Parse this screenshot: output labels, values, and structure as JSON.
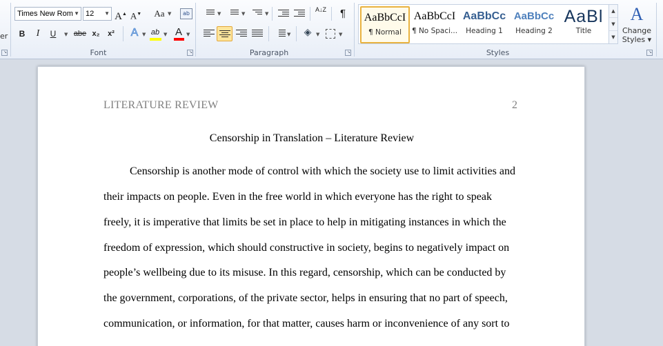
{
  "ribbon": {
    "left_edge_text": "er",
    "font": {
      "family_value": "Times New Rom",
      "size_value": "12",
      "grow_font_label": "A",
      "shrink_font_label": "A",
      "change_case_label": "Aa",
      "bold_label": "B",
      "italic_label": "I",
      "underline_label": "U",
      "strikethrough_label": "abe",
      "subscript_label": "x₂",
      "superscript_label": "x²",
      "text_effects_label": "A",
      "highlight_label": "ab",
      "font_color_label": "A",
      "group_label": "Font"
    },
    "paragraph": {
      "sort_label": "A↓Z",
      "show_marks_label": "¶",
      "group_label": "Paragraph"
    },
    "styles": {
      "items": [
        {
          "sample": "AaBbCcI",
          "name": "¶ Normal"
        },
        {
          "sample": "AaBbCcI",
          "name": "¶ No Spaci..."
        },
        {
          "sample": "AaBbCc",
          "name": "Heading 1"
        },
        {
          "sample": "AaBbCc",
          "name": "Heading 2"
        },
        {
          "sample": "AaBl",
          "name": "Title"
        }
      ],
      "group_label": "Styles",
      "change_styles_line1": "Change",
      "change_styles_line2": "Styles ▾"
    }
  },
  "document": {
    "header_left": "LITERATURE REVIEW",
    "page_number": "2",
    "title": "Censorship in Translation – Literature Review",
    "lines": [
      "Censorship is another mode of control with which the society use to limit activities and",
      "their impacts on people. Even in the free world in which everyone has the right to speak",
      "freely, it is imperative that limits be set in place to help in mitigating instances in which the",
      "freedom of expression, which should constructive in society, begins to negatively impact on",
      "people’s wellbeing due to its misuse. In this regard, censorship, which can be conducted by",
      "the government, corporations, of the private sector, helps in ensuring that no part of speech,",
      "communication, or information, for that matter, causes harm or inconvenience of any sort to"
    ]
  },
  "colors": {
    "highlight": "#ffff00",
    "font_color": "#ff0000",
    "selected_style_border": "#e9b23f",
    "heading_blue": "#365f91"
  }
}
